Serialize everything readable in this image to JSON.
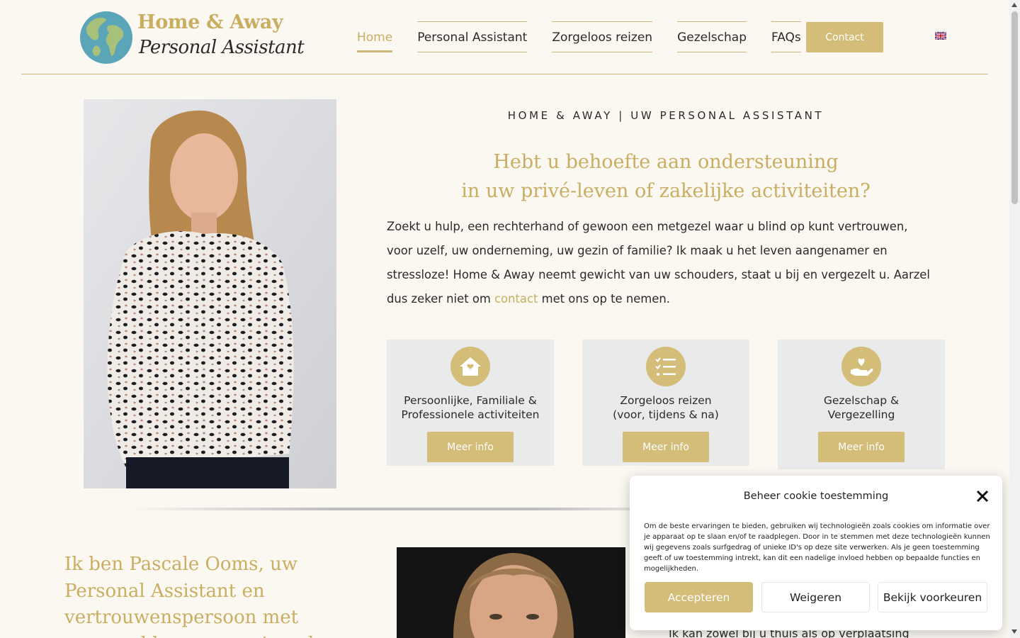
{
  "brand": {
    "title": "Home & Away",
    "subtitle": "Personal Assistant"
  },
  "nav": {
    "items": [
      {
        "label": "Home"
      },
      {
        "label": "Personal Assistant"
      },
      {
        "label": "Zorgeloos reizen"
      },
      {
        "label": "Gezelschap"
      },
      {
        "label": "FAQs"
      }
    ],
    "contact_label": "Contact"
  },
  "hero": {
    "eyebrow": "HOME & AWAY | UW PERSONAL ASSISTANT",
    "headline_line1": "Hebt u behoefte aan ondersteuning",
    "headline_line2": "in uw privé-leven of zakelijke activiteiten?",
    "intro_before_link": "Zoekt u hulp, een rechterhand of gewoon een metgezel waar u blind op kunt vertrouwen, voor uzelf, uw onderneming, uw gezin of familie? Ik maak u het leven aangenamer en stressloze! Home & Away neemt gewicht van uw schouders, staat u bij en vergezelt u. Aarzel dus zeker niet om ",
    "intro_link": "contact",
    "intro_after_link": " met ons op te nemen."
  },
  "cards": [
    {
      "line1": "Persoonlijke, Familiale &",
      "line2": "Professionele activiteiten",
      "button": "Meer info",
      "icon": "house-icon"
    },
    {
      "line1": "Zorgeloos reizen",
      "line2": "(voor, tijdens & na)",
      "button": "Meer info",
      "icon": "checklist-icon"
    },
    {
      "line1": "Gezelschap &",
      "line2": "Vergezelling",
      "button": "Meer info",
      "icon": "heart-hand-icon"
    }
  ],
  "about": {
    "title": "Ik ben Pascale Ooms, uw Personal Assistant en vertrouwenspersoon met evenveel levenservaring als",
    "partial_text": "Ik kan zowel bij u thuis als op verplaatsing"
  },
  "cookie": {
    "title": "Beheer cookie toestemming",
    "body": "Om de beste ervaringen te bieden, gebruiken wij technologieën zoals cookies om informatie over je apparaat op te slaan en/of te raadplegen. Door in te stemmen met deze technologieën kunnen wij gegevens zoals surfgedrag of unieke ID's op deze site verwerken. Als je geen toestemming geeft of uw toestemming intrekt, kan dit een nadelige invloed hebben op bepaalde functies en mogelijkheden.",
    "accept": "Accepteren",
    "deny": "Weigeren",
    "prefs": "Bekijk voorkeuren"
  },
  "colors": {
    "gold": "#d4bd78",
    "gold_text": "#c9ae62",
    "background": "#fbf8f2",
    "card_bg": "#e9eaea"
  }
}
